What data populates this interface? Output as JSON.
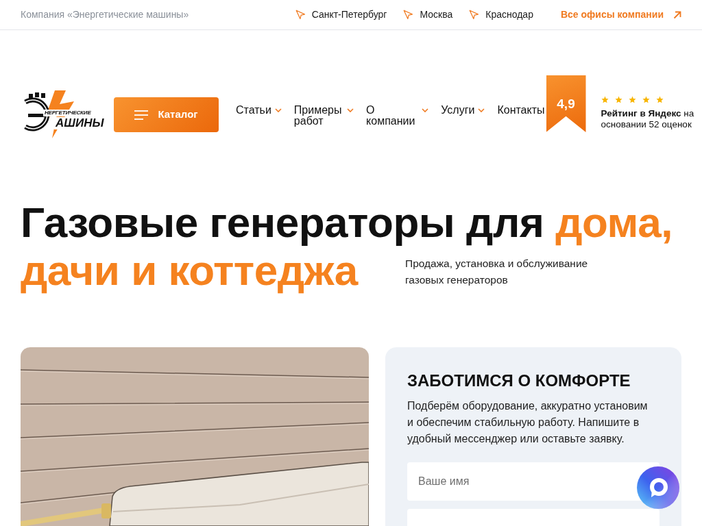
{
  "top_bar": {
    "company": "Компания «Энергетические машины»",
    "cities": [
      "Санкт-Петербург",
      "Москва",
      "Краснодар"
    ],
    "all_offices": "Все офисы компании"
  },
  "logo": {
    "line_1": "НЕРГЕТИЧЕСКИЕ",
    "line_2": "АШИНЫ"
  },
  "catalog_button": "Каталог",
  "nav": [
    {
      "label": "Статьи",
      "has_dropdown": true
    },
    {
      "label": "Примеры работ",
      "has_dropdown": true
    },
    {
      "label": "О компании",
      "has_dropdown": true
    },
    {
      "label": "Услуги",
      "has_dropdown": true
    },
    {
      "label": "Контакты",
      "has_dropdown": false
    }
  ],
  "rating": {
    "value": "4,9",
    "stars": 5,
    "text": "**Рейтинг в Яндекс** на основании 52 оценок"
  },
  "hero": {
    "title_lines": [
      [
        {
          "text": "Газовые генераторы для ",
          "accent": false
        },
        {
          "text": "дома,",
          "accent": true
        }
      ],
      [
        {
          "text": "дачи и коттеджа",
          "accent": true
        }
      ]
    ],
    "subtitle": "Продажа, установка и обслуживание газовых генераторов"
  },
  "form": {
    "title": "ЗАБОТИМСЯ О КОМФОРТЕ",
    "text": "Подберём оборудование, аккуратно установим и обеспечим стабильную работу. Напишите в удобный мессенджер или оставьте заявку.",
    "fields": [
      {
        "kind": "text",
        "placeholder": "Ваше имя"
      },
      {
        "kind": "text"
      }
    ]
  }
}
